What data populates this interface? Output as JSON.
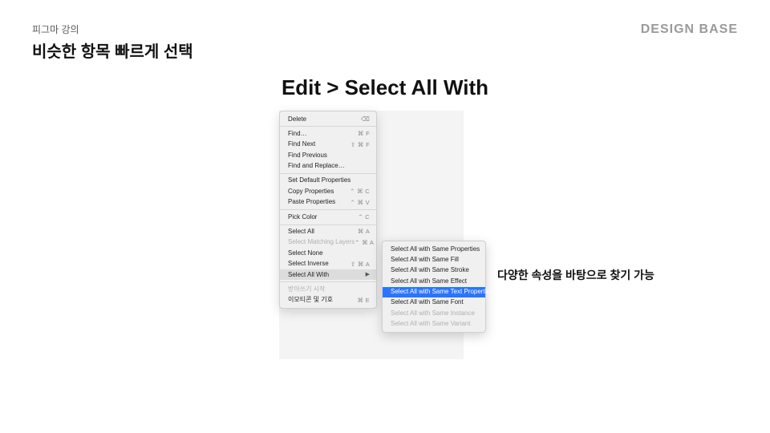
{
  "header": {
    "sub": "피그마 강의",
    "title": "비슷한 항목 빠르게 선택",
    "brand": "DESIGN BASE"
  },
  "main_title": "Edit > Select All With",
  "menu": {
    "delete": {
      "label": "Delete",
      "shortcut": "⌫"
    },
    "find": {
      "label": "Find…",
      "shortcut": "⌘ F"
    },
    "find_next": {
      "label": "Find Next",
      "shortcut": "⇧ ⌘ F"
    },
    "find_previous": {
      "label": "Find Previous",
      "shortcut": ""
    },
    "find_replace": {
      "label": "Find and Replace…",
      "shortcut": ""
    },
    "set_default": {
      "label": "Set Default Properties",
      "shortcut": ""
    },
    "copy_props": {
      "label": "Copy Properties",
      "shortcut": "⌃ ⌘ C"
    },
    "paste_props": {
      "label": "Paste Properties",
      "shortcut": "⌃ ⌘ V"
    },
    "pick_color": {
      "label": "Pick Color",
      "shortcut": "⌃ C"
    },
    "select_all": {
      "label": "Select All",
      "shortcut": "⌘ A"
    },
    "select_matching": {
      "label": "Select Matching Layers",
      "shortcut": "⌃ ⌘ A"
    },
    "select_none": {
      "label": "Select None",
      "shortcut": ""
    },
    "select_inverse": {
      "label": "Select Inverse",
      "shortcut": "⇧ ⌘ A"
    },
    "select_all_with": {
      "label": "Select All With"
    },
    "dictation": {
      "label": "받아쓰기 시작",
      "shortcut": ""
    },
    "emoji": {
      "label": "이모티콘 및 기호",
      "shortcut": "⌘ E"
    }
  },
  "submenu": {
    "same_properties": "Select All with Same Properties",
    "same_fill": "Select All with Same Fill",
    "same_stroke": "Select All with Same Stroke",
    "same_effect": "Select All with Same Effect",
    "same_text": "Select All with Same Text Properties",
    "same_font": "Select All with Same Font",
    "same_instance": "Select All with Same Instance",
    "same_variant": "Select All with Same Variant"
  },
  "annotation": "다양한 속성을 바탕으로 찾기 가능"
}
